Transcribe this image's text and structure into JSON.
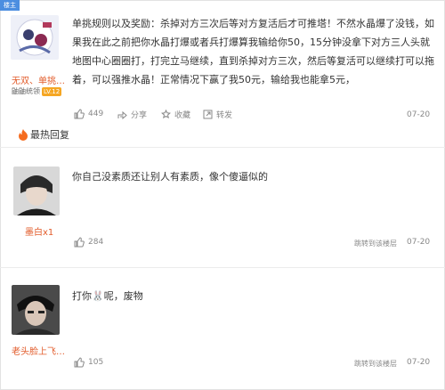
{
  "corner_badge": "楼主",
  "post": {
    "user_name": "无双、单挑…",
    "user_title": "鼬鼬统领",
    "user_level": "LV.12",
    "text": "单挑规则以及奖励：杀掉对方三次后等对方复活后才可推塔！不然水晶爆了没钱，如果我在此之前把你水晶打爆或者兵打爆算我输给你50，15分钟没拿下对方三人头就地图中心圈圈打，打完立马继续，直到杀掉对方三次，然后等复活可以继续打可以拖着，可以强推水晶！正常情况下赢了我50元，输给我也能拿5元，",
    "likes": "449",
    "share_label": "分享",
    "fav_label": "收藏",
    "forward_label": "转发",
    "date": "07-20"
  },
  "hot_section_title": "最热回复",
  "replies": [
    {
      "user_name": "墨白x1",
      "text": "你自己没素质还让别人有素质，像个傻逼似的",
      "likes": "284",
      "jump_label": "跳转到该楼层",
      "date": "07-20"
    },
    {
      "user_name": "老头脸上飞…",
      "text": "打你🐰呢，废物",
      "likes": "105",
      "jump_label": "跳转到该楼层",
      "date": "07-20"
    }
  ],
  "colors": {
    "accent_name": "#e25c2b",
    "badge_blue": "#4c8ee0",
    "level_orange": "#f5a623",
    "divider": "#ececec"
  }
}
